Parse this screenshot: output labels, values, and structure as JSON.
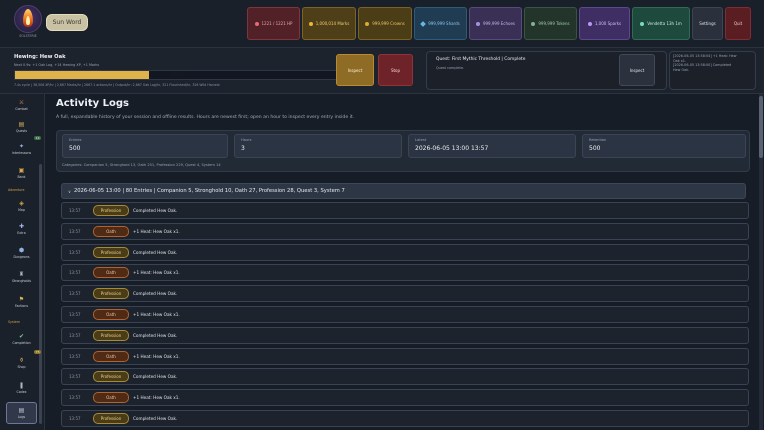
{
  "app": {
    "logo_caption": "SOLSTERIE",
    "primary_button": "Sun Word"
  },
  "resources": {
    "hp": "1221 / 1221 HP",
    "marks": "1,000,014 Marks",
    "crowns": "999,999 Crowns",
    "shards": "999,999 Shards",
    "echoes": "999,999 Echoes",
    "tokens": "999,999 Tokens",
    "sparks": "1,000 Sparks",
    "vendetta": "Vendetta 13h 1m",
    "settings_label": "Settings",
    "quit_label": "Quit"
  },
  "activity": {
    "title": "Hewing: Hew Oak",
    "subtitle": "Next 0.9s: +1 Oak Log, +14 Hewing XP, +1 Marks",
    "progress": 0.41,
    "progress_label": "41%",
    "stats": "7.4s cycle | 38,506 XP/hr | 2,667 Marks/hr | 2667.1 actions/hr | Output/hr: 2,667 Oak Log/hr, 321 Flourished/hr, 326 Wild Harvest",
    "inspect_label": "Inspect",
    "stop_label": "Stop"
  },
  "quest": {
    "title": "Quest: First Mythic Threshold | Complete",
    "subtitle": "Quest complete.",
    "inspect_label": "Inspect"
  },
  "feed": {
    "lines": [
      "[2026-06-05 13:58:04] +1 Heat: Hew",
      "Oak x1.",
      "[2026-06-05 13:58:00] Completed",
      "Hew Oak."
    ]
  },
  "sidebar": {
    "items": [
      {
        "label": "Combat",
        "glyph": "⚔",
        "color": "#d88a4a"
      },
      {
        "label": "Quests",
        "glyph": "📜",
        "color": "#d8b45a"
      },
      {
        "label": "Interlessons",
        "glyph": "✦",
        "color": "#8fb4e0",
        "badge": "14"
      },
      {
        "label": "Bank",
        "glyph": "▣",
        "color": "#d8a94a"
      }
    ],
    "section_adventure": "Adventure",
    "adventure_items": [
      {
        "label": "Map",
        "glyph": "◈",
        "color": "#d8a94a"
      },
      {
        "label": "Extra",
        "glyph": "✚",
        "color": "#9fb4f0"
      },
      {
        "label": "Dungeons",
        "glyph": "⬢",
        "color": "#8fb4e0"
      },
      {
        "label": "Strongholds",
        "glyph": "♜",
        "color": "#b4b4c8"
      },
      {
        "label": "Factions",
        "glyph": "⚑",
        "color": "#d8b45a"
      }
    ],
    "section_system": "System",
    "system_items": [
      {
        "label": "Completion",
        "glyph": "✔",
        "color": "#6fd08a"
      },
      {
        "label": "Shop",
        "glyph": "⚱",
        "color": "#d8b45a",
        "badge": "75"
      },
      {
        "label": "Codex",
        "glyph": "❚",
        "color": "#b4b4c8"
      },
      {
        "label": "Logs",
        "glyph": "▤",
        "color": "#c8cce0",
        "active": true
      }
    ]
  },
  "page": {
    "title": "Activity Logs",
    "description": "A full, expandable history of your session and offline results. Hours are newest first; open an hour to inspect every entry inside it."
  },
  "summary": {
    "cards": [
      {
        "key": "Entries",
        "value": "500"
      },
      {
        "key": "Hours",
        "value": "3"
      },
      {
        "key": "Latest",
        "value": "2026-06-05 13:00 13:57"
      },
      {
        "key": "Retention",
        "value": "500"
      }
    ],
    "categories": "Categories: Companion 5, Stronghold 13, Oath 251, Profession 229, Quest 4, System 14"
  },
  "group": {
    "header": "2026-06-05 13:00  |  80 Entries  |  Companion 5, Stronghold 10, Oath 27, Profession 28, Quest 3, System 7",
    "rows": [
      {
        "time": "13:57",
        "tag": "Profession",
        "kind": "profession",
        "msg": "Completed Hew Oak."
      },
      {
        "time": "13:57",
        "tag": "Oath",
        "kind": "oath",
        "msg": "+1 Heat: Hew Oak x1."
      },
      {
        "time": "13:57",
        "tag": "Profession",
        "kind": "profession",
        "msg": "Completed Hew Oak."
      },
      {
        "time": "13:57",
        "tag": "Oath",
        "kind": "oath",
        "msg": "+1 Heat: Hew Oak x1."
      },
      {
        "time": "13:57",
        "tag": "Profession",
        "kind": "profession",
        "msg": "Completed Hew Oak."
      },
      {
        "time": "13:57",
        "tag": "Oath",
        "kind": "oath",
        "msg": "+1 Heat: Hew Oak x1."
      },
      {
        "time": "13:57",
        "tag": "Profession",
        "kind": "profession",
        "msg": "Completed Hew Oak."
      },
      {
        "time": "13:57",
        "tag": "Oath",
        "kind": "oath",
        "msg": "+1 Heat: Hew Oak x1."
      },
      {
        "time": "13:57",
        "tag": "Profession",
        "kind": "profession",
        "msg": "Completed Hew Oak."
      },
      {
        "time": "13:57",
        "tag": "Oath",
        "kind": "oath",
        "msg": "+1 Heat: Hew Oak x1."
      },
      {
        "time": "13:57",
        "tag": "Profession",
        "kind": "profession",
        "msg": "Completed Hew Oak."
      }
    ]
  }
}
